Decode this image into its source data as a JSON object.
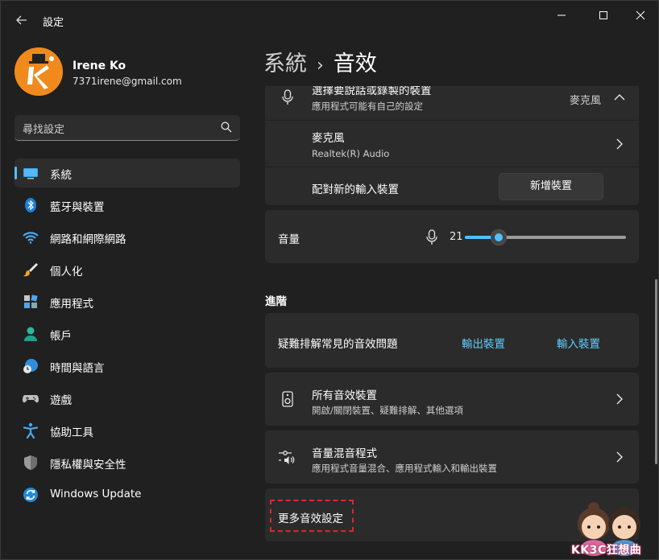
{
  "window": {
    "title": "設定",
    "back_icon": "back-arrow-icon",
    "controls": [
      "minimize",
      "maximize",
      "close"
    ]
  },
  "profile": {
    "name": "Irene Ko",
    "email": "7371irene@gmail.com"
  },
  "search": {
    "placeholder": "尋找設定"
  },
  "nav": {
    "items": [
      {
        "label": "系統",
        "icon": "monitor-icon",
        "active": true
      },
      {
        "label": "藍牙與裝置",
        "icon": "bluetooth-icon"
      },
      {
        "label": "網路和網際網路",
        "icon": "wifi-icon"
      },
      {
        "label": "個人化",
        "icon": "paintbrush-icon"
      },
      {
        "label": "應用程式",
        "icon": "apps-icon"
      },
      {
        "label": "帳戶",
        "icon": "person-icon"
      },
      {
        "label": "時間與語言",
        "icon": "globe-clock-icon"
      },
      {
        "label": "遊戲",
        "icon": "gamepad-icon"
      },
      {
        "label": "協助工具",
        "icon": "accessibility-icon"
      },
      {
        "label": "隱私權與安全性",
        "icon": "shield-icon"
      },
      {
        "label": "Windows Update",
        "icon": "update-icon"
      }
    ]
  },
  "breadcrumb": {
    "parent": "系統",
    "separator": "›",
    "current": "音效"
  },
  "input_section": {
    "choose_device": {
      "title": "選擇要說話或錄製的裝置",
      "subtitle": "應用程式可能有自己的設定",
      "value": "麥克風"
    },
    "microphone": {
      "title": "麥克風",
      "subtitle": "Realtek(R) Audio"
    },
    "pair_new": {
      "title": "配對新的輸入裝置",
      "button": "新增裝置"
    },
    "volume": {
      "title": "音量",
      "value_label": "21",
      "value": 21
    }
  },
  "advanced": {
    "heading": "進階",
    "troubleshoot": {
      "title": "疑難排解常見的音效問題",
      "link_output": "輸出裝置",
      "link_input": "輸入裝置"
    },
    "all_devices": {
      "title": "所有音效裝置",
      "subtitle": "開啟/關閉裝置、疑難排解、其他選項"
    },
    "mixer": {
      "title": "音量混音程式",
      "subtitle": "應用程式音量混合、應用程式輸入和輸出裝置"
    },
    "more_settings": {
      "title": "更多音效設定"
    }
  },
  "watermark": {
    "text": "KK3C狂想曲"
  },
  "colors": {
    "accent": "#4cc2ff",
    "link": "#60cdff",
    "highlight": "#d52b2b"
  }
}
